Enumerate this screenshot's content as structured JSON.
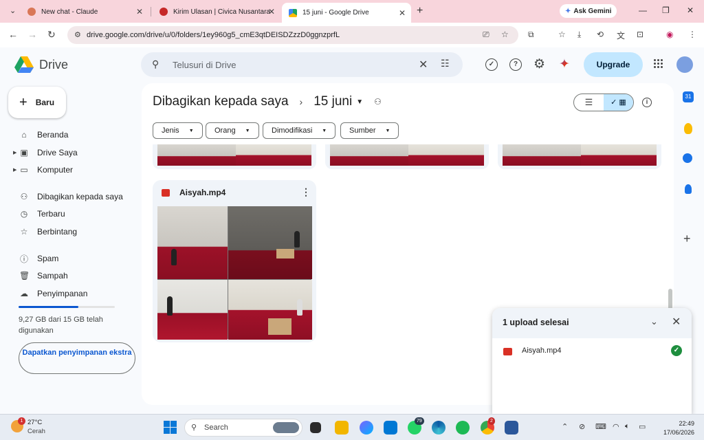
{
  "browser": {
    "tabs": [
      {
        "label": "New chat - Claude",
        "favicon_color": "#d97757"
      },
      {
        "label": "Kirim Ulasan | Civica Nusantara",
        "favicon_color": "#c62828"
      },
      {
        "label": "15 juni - Google Drive",
        "favicon_color": "#1a73e8",
        "active": true
      }
    ],
    "new_tab_symbol": "+",
    "ask_gemini": "Ask Gemini",
    "url": "drive.google.com/drive/u/0/folders/1ey960g5_cmE3qtDEISDZzzD0ggnzprfL"
  },
  "drive": {
    "app_name": "Drive",
    "search_placeholder": "Telusuri di Drive",
    "upgrade_label": "Upgrade",
    "new_button": "Baru",
    "nav": [
      {
        "label": "Beranda",
        "icon": "home-icon"
      },
      {
        "label": "Drive Saya",
        "icon": "my-drive-icon"
      },
      {
        "label": "Komputer",
        "icon": "computer-icon"
      },
      {
        "label": "Dibagikan kepada saya",
        "icon": "shared-icon"
      },
      {
        "label": "Terbaru",
        "icon": "clock-icon"
      },
      {
        "label": "Berbintang",
        "icon": "star-icon"
      },
      {
        "label": "Spam",
        "icon": "spam-icon"
      },
      {
        "label": "Sampah",
        "icon": "trash-icon"
      },
      {
        "label": "Penyimpanan",
        "icon": "cloud-icon"
      }
    ],
    "storage": {
      "used_fraction": 0.618,
      "text": "9,27 GB dari 15 GB telah digunakan",
      "button": "Dapatkan penyimpanan ekstra"
    },
    "breadcrumb": {
      "parent": "Dibagikan kepada saya",
      "current": "15 juni"
    },
    "filters": [
      "Jenis",
      "Orang",
      "Dimodifikasi",
      "Sumber"
    ],
    "files": [
      {
        "name": "Aisyah.mp4",
        "type": "video"
      }
    ],
    "upload_panel": {
      "title": "1 upload selesai",
      "items": [
        {
          "name": "Aisyah.mp4",
          "status": "complete"
        }
      ]
    }
  },
  "taskbar": {
    "weather_temp": "27°C",
    "weather_cond": "Cerah",
    "weather_badge": "1",
    "search_label": "Search",
    "whatsapp_badge": "79",
    "chrome_badge": "2",
    "time": "22:49",
    "date": "17/06/2026"
  }
}
